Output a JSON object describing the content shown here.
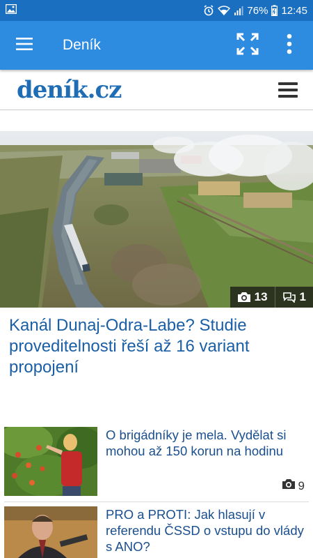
{
  "status_bar": {
    "battery": "76%",
    "time": "12:45"
  },
  "app_bar": {
    "title": "Deník"
  },
  "site": {
    "logo_main": "deník",
    "logo_tld": ".cz"
  },
  "hero": {
    "photo_count": "13",
    "comment_count": "1",
    "title": "Kanál Dunaj-Odra-Labe? Studie proveditelnosti řeší až 16 variant propojení"
  },
  "articles": [
    {
      "title": "O brigádníky je mela. Vydělat si mohou až 150 korun na hodinu",
      "photo_count": "9"
    },
    {
      "title": "PRO a PROTI: Jak hlasují v referendu ČSSD o vstupu do vlády s ANO?"
    }
  ],
  "colors": {
    "status_bar": "#1b6fc0",
    "app_bar": "#2d8be0",
    "logo": "#1f6db5",
    "headline": "#1a5fa6"
  }
}
